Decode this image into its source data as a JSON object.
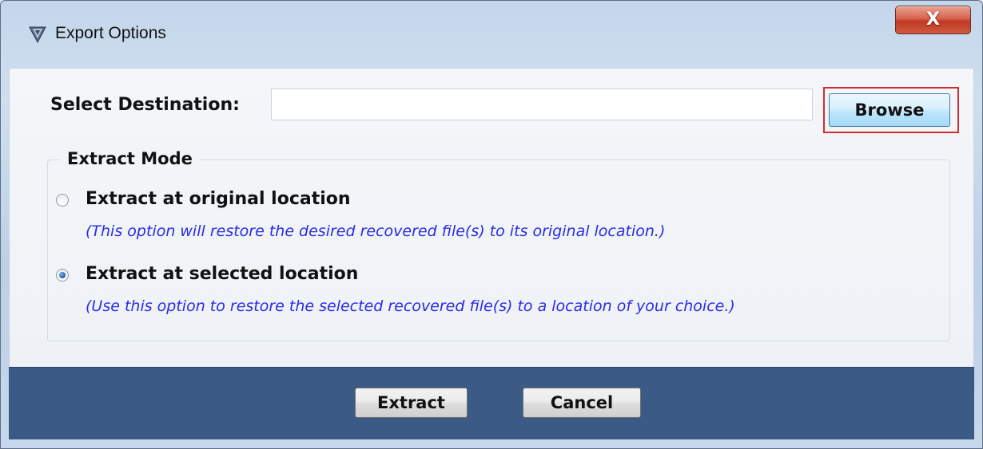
{
  "window": {
    "title": "Export Options",
    "icon": "shield-logo-icon",
    "close_label": "X"
  },
  "destination": {
    "label": "Select Destination:",
    "value": "",
    "placeholder": "",
    "browse_label": "Browse"
  },
  "extract_mode": {
    "legend": "Extract Mode",
    "options": [
      {
        "label": "Extract at original location",
        "description": "(This option will restore the desired recovered file(s) to its original location.)",
        "selected": false
      },
      {
        "label": "Extract at selected location",
        "description": "(Use this option to restore the selected recovered file(s) to a location of your choice.)",
        "selected": true
      }
    ]
  },
  "footer": {
    "extract_label": "Extract",
    "cancel_label": "Cancel"
  },
  "colors": {
    "footer_bg": "#3b5a86",
    "description_text": "#2b2be6",
    "highlight_border": "#d42b2b",
    "close_button": "#c03a22"
  }
}
